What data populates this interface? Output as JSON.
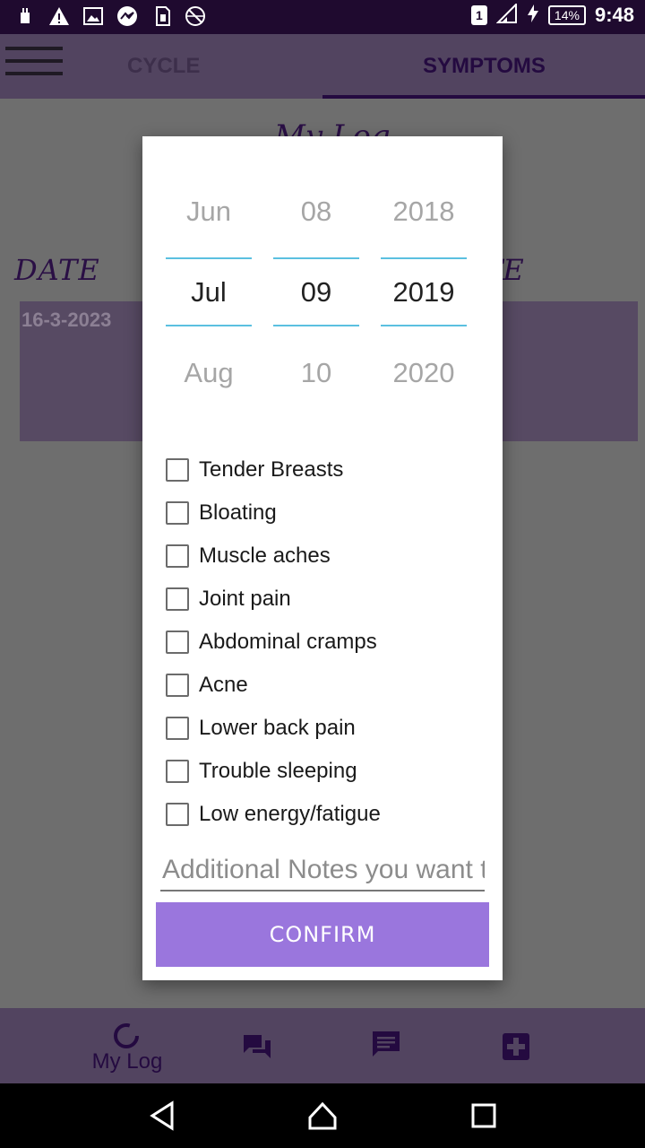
{
  "status_bar": {
    "time": "9:48",
    "battery": "14%",
    "sim": "1",
    "left_icons": [
      "usb-icon",
      "warning-icon",
      "image-icon",
      "messenger-icon",
      "sim-icon",
      "no-network-icon"
    ]
  },
  "app_bar": {
    "tabs": [
      "CYCLE",
      "SYMPTOMS"
    ],
    "active_tab": "SYMPTOMS"
  },
  "content": {
    "title": "My Log",
    "date_header": "DATE",
    "date_header_right": "TE",
    "log_entry_date": "16-3-2023"
  },
  "dialog": {
    "picker": {
      "month": {
        "prev": "Jun",
        "current": "Jul",
        "next": "Aug"
      },
      "day": {
        "prev": "08",
        "current": "09",
        "next": "10"
      },
      "year": {
        "prev": "2018",
        "current": "2019",
        "next": "2020"
      }
    },
    "symptoms": [
      "Tender Breasts",
      "Bloating",
      "Muscle aches",
      "Joint pain",
      "Abdominal cramps",
      "Acne",
      "Lower back pain",
      "Trouble sleeping",
      "Low energy/fatigue"
    ],
    "notes_placeholder": "Additional Notes you want to add",
    "confirm_label": "CONFIRM"
  },
  "bottom_nav": {
    "items": [
      {
        "label": "My Log",
        "icon": "loading-ring-icon"
      },
      {
        "label": "",
        "icon": "forum-icon"
      },
      {
        "label": "",
        "icon": "chat-icon"
      },
      {
        "label": "",
        "icon": "medical-plus-icon"
      }
    ]
  },
  "colors": {
    "status_bar": "#1f0a2f",
    "accent_purple": "#9a76dd",
    "picker_line": "#5bc0e0",
    "dark_purple_text": "#240a40"
  }
}
